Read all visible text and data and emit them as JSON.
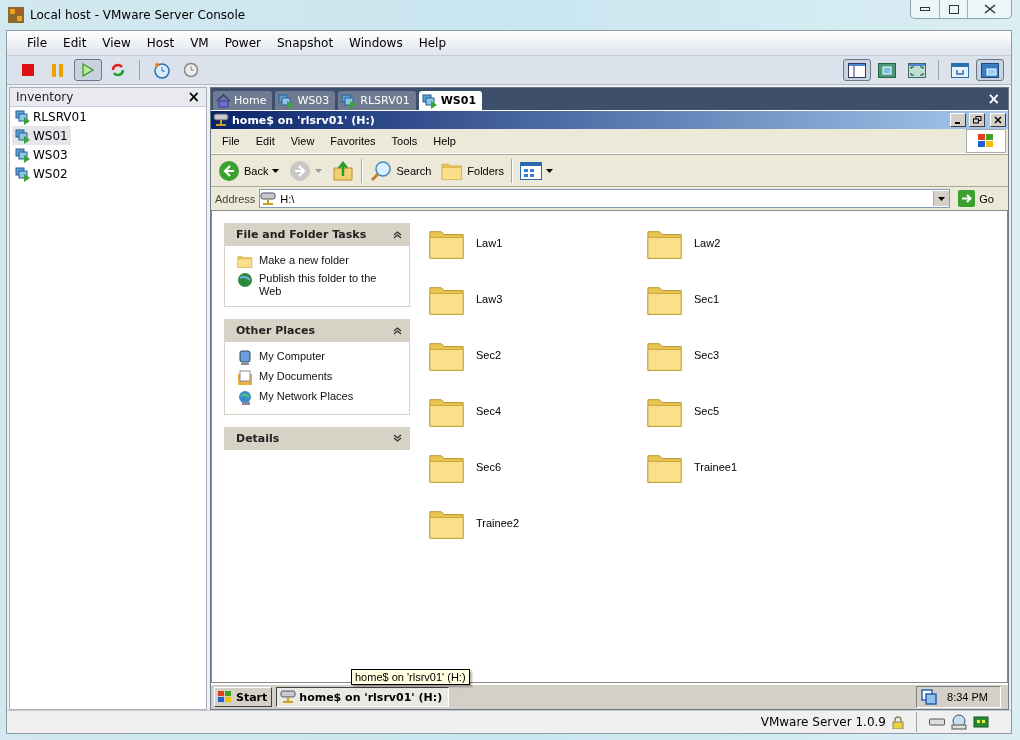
{
  "window": {
    "title": "Local host - VMware Server Console"
  },
  "menu": [
    "File",
    "Edit",
    "View",
    "Host",
    "VM",
    "Power",
    "Snapshot",
    "Windows",
    "Help"
  ],
  "toolbar": [
    {
      "kind": "stop",
      "pressed": false
    },
    {
      "kind": "pause",
      "pressed": false
    },
    {
      "kind": "play",
      "pressed": true
    },
    {
      "kind": "reset",
      "pressed": false
    },
    {
      "kind": "sep"
    },
    {
      "kind": "snapshot",
      "pressed": false
    },
    {
      "kind": "revert",
      "pressed": false
    }
  ],
  "view_toolbar": [
    {
      "kind": "sidebar",
      "pressed": true
    },
    {
      "kind": "fit",
      "pressed": false
    },
    {
      "kind": "fullscreen",
      "pressed": false
    },
    {
      "kind": "sep"
    },
    {
      "kind": "settings",
      "pressed": false
    },
    {
      "kind": "quickswitch",
      "pressed": true
    }
  ],
  "inventory": {
    "title": "Inventory",
    "close": "×",
    "items": [
      {
        "label": "RLSRV01",
        "selected": false
      },
      {
        "label": "WS01",
        "selected": true
      },
      {
        "label": "WS03",
        "selected": false
      },
      {
        "label": "WS02",
        "selected": false
      }
    ]
  },
  "tabs": [
    {
      "label": "Home",
      "kind": "home",
      "selected": false
    },
    {
      "label": "WS03",
      "kind": "vm",
      "selected": false
    },
    {
      "label": "RLSRV01",
      "kind": "vm",
      "selected": false
    },
    {
      "label": "WS01",
      "kind": "vm",
      "selected": true
    }
  ],
  "tabs_close": "×",
  "guest": {
    "title": "home$ on 'rlsrv01' (H:)",
    "menu": [
      "File",
      "Edit",
      "View",
      "Favorites",
      "Tools",
      "Help"
    ],
    "toolbar": {
      "back": "Back",
      "search": "Search",
      "folders": "Folders"
    },
    "address": {
      "label": "Address",
      "value": "H:\\",
      "go": "Go"
    },
    "panels": [
      {
        "title": "File and Folder Tasks",
        "expanded": true,
        "items": [
          {
            "label": "Make a new folder",
            "kind": "newfolder"
          },
          {
            "label": "Publish this folder to the Web",
            "kind": "publish"
          }
        ]
      },
      {
        "title": "Other Places",
        "expanded": true,
        "items": [
          {
            "label": "My Computer",
            "kind": "computer"
          },
          {
            "label": "My Documents",
            "kind": "documents"
          },
          {
            "label": "My Network Places",
            "kind": "network"
          }
        ]
      },
      {
        "title": "Details",
        "expanded": false
      }
    ],
    "folders": [
      "Law1",
      "Law2",
      "Law3",
      "Sec1",
      "Sec2",
      "Sec3",
      "Sec4",
      "Sec5",
      "Sec6",
      "Trainee1",
      "Trainee2"
    ],
    "tooltip": "home$ on 'rlsrv01' (H:)",
    "taskbar": {
      "start": "Start",
      "task": "home$ on 'rlsrv01' (H:)",
      "clock": "8:34 PM"
    }
  },
  "status_bar": {
    "text": "VMware Server 1.0.9"
  }
}
